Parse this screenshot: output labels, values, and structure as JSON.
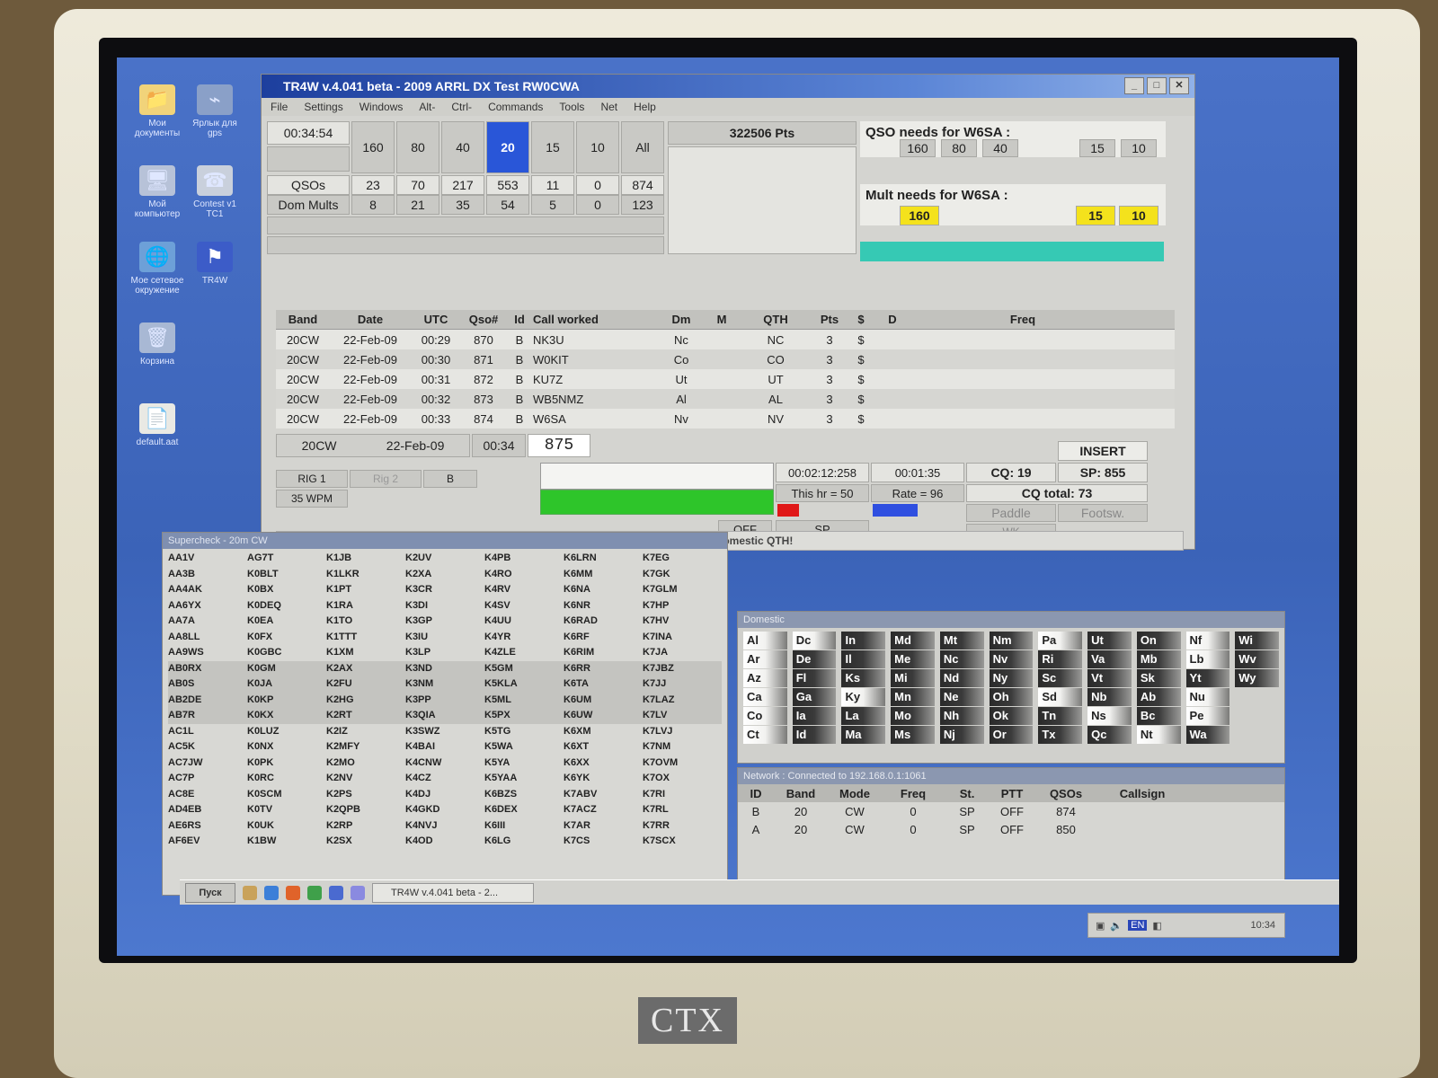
{
  "window": {
    "title": "TR4W v.4.041 beta - 2009 ARRL DX Test RW0CWA",
    "menu": [
      "File",
      "Settings",
      "Windows",
      "Alt-",
      "Ctrl-",
      "Commands",
      "Tools",
      "Net",
      "Help"
    ]
  },
  "summary": {
    "time": "00:34:54",
    "points": "322506 Pts",
    "bands": [
      "160",
      "80",
      "40",
      "20",
      "15",
      "10",
      "All"
    ],
    "active_band": "20",
    "qsos_label": "QSOs",
    "qsos": [
      "23",
      "70",
      "217",
      "553",
      "11",
      "0",
      "874"
    ],
    "mults_label": "Dom Mults",
    "mults": [
      "8",
      "21",
      "35",
      "54",
      "5",
      "0",
      "123"
    ]
  },
  "qso_needs": {
    "label": "QSO needs for W6SA :",
    "bands": [
      "160",
      "80",
      "40",
      "15",
      "10"
    ]
  },
  "mult_needs": {
    "label": "Mult needs for W6SA :",
    "bands": [
      "160",
      "15",
      "10"
    ],
    "highlight_color": "#f4e21c"
  },
  "log": {
    "columns": [
      "Band",
      "Date",
      "UTC",
      "Qso#",
      "Id",
      "Call worked",
      "Dm",
      "M",
      "QTH",
      "Pts",
      "$",
      "D",
      "Freq"
    ],
    "rows": [
      [
        "20CW",
        "22-Feb-09",
        "00:29",
        "870",
        "B",
        "NK3U",
        "Nc",
        "",
        "NC",
        "3",
        "$"
      ],
      [
        "20CW",
        "22-Feb-09",
        "00:30",
        "871",
        "B",
        "W0KIT",
        "Co",
        "",
        "CO",
        "3",
        "$"
      ],
      [
        "20CW",
        "22-Feb-09",
        "00:31",
        "872",
        "B",
        "KU7Z",
        "Ut",
        "",
        "UT",
        "3",
        "$"
      ],
      [
        "20CW",
        "22-Feb-09",
        "00:32",
        "873",
        "B",
        "WB5NMZ",
        "Al",
        "",
        "AL",
        "3",
        "$"
      ],
      [
        "20CW",
        "22-Feb-09",
        "00:33",
        "874",
        "B",
        "W6SA",
        "Nv",
        "",
        "NV",
        "3",
        "$"
      ]
    ]
  },
  "entry": {
    "band": "20CW",
    "date": "22-Feb-09",
    "utc": "00:34",
    "qso_number": "875",
    "rig1": "RIG 1",
    "rig2": "Rig 2",
    "rig_id": "B",
    "wpm": "35 WPM"
  },
  "stats": {
    "elapsed": "00:02:12:258",
    "timer": "00:01:35",
    "this_hr": "This hr = 50",
    "rate": "Rate = 96",
    "cq": "CQ: 19",
    "sp": "SP: 855",
    "cq_total": "CQ total: 73",
    "mode": "INSERT",
    "paddle": "Paddle",
    "footsw": "Footsw.",
    "wk": "WK",
    "off": "OFF",
    "sp_label": "SP"
  },
  "status_msg": "Improper domestic QTH!",
  "supercheck": {
    "title": "Supercheck - 20m CW",
    "calls": [
      "AA1V",
      "AG7T",
      "K1JB",
      "K2UV",
      "K4PB",
      "K6LRN",
      "K7EG",
      "AA3B",
      "K0BLT",
      "K1LKR",
      "K2XA",
      "K4RO",
      "K6MM",
      "K7GK",
      "AA4AK",
      "K0BX",
      "K1PT",
      "K3CR",
      "K4RV",
      "K6NA",
      "K7GLM",
      "AA6YX",
      "K0DEQ",
      "K1RA",
      "K3DI",
      "K4SV",
      "K6NR",
      "K7HP",
      "AA7A",
      "K0EA",
      "K1TO",
      "K3GP",
      "K4UU",
      "K6RAD",
      "K7HV",
      "AA8LL",
      "K0FX",
      "K1TTT",
      "K3IU",
      "K4YR",
      "K6RF",
      "K7INA",
      "AA9WS",
      "K0GBC",
      "K1XM",
      "K3LP",
      "K4ZLE",
      "K6RIM",
      "K7JA",
      "AB0RX",
      "K0GM",
      "K2AX",
      "K3ND",
      "K5GM",
      "K6RR",
      "K7JBZ",
      "AB0S",
      "K0JA",
      "K2FU",
      "K3NM",
      "K5KLA",
      "K6TA",
      "K7JJ",
      "AB2DE",
      "K0KP",
      "K2HG",
      "K3PP",
      "K5ML",
      "K6UM",
      "K7LAZ",
      "AB7R",
      "K0KX",
      "K2RT",
      "K3QIA",
      "K5PX",
      "K6UW",
      "K7LV",
      "AC1L",
      "K0LUZ",
      "K2IZ",
      "K3SWZ",
      "K5TG",
      "K6XM",
      "K7LVJ",
      "AC5K",
      "K0NX",
      "K2MFY",
      "K4BAI",
      "K5WA",
      "K6XT",
      "K7NM",
      "AC7JW",
      "K0PK",
      "K2MO",
      "K4CNW",
      "K5YA",
      "K6XX",
      "K7OVM",
      "AC7P",
      "K0RC",
      "K2NV",
      "K4CZ",
      "K5YAA",
      "K6YK",
      "K7OX",
      "AC8E",
      "K0SCM",
      "K2PS",
      "K4DJ",
      "K6BZS",
      "K7ABV",
      "K7RI",
      "AD4EB",
      "K0TV",
      "K2QPB",
      "K4GKD",
      "K6DEX",
      "K7ACZ",
      "K7RL",
      "AE6RS",
      "K0UK",
      "K2RP",
      "K4NVJ",
      "K6III",
      "K7AR",
      "K7RR",
      "AF6EV",
      "K1BW",
      "K2SX",
      "K4OD",
      "K6LG",
      "K7CS",
      "K7SCX"
    ]
  },
  "domestic": {
    "title": "Domestic",
    "items": [
      {
        "t": "Al",
        "s": "w"
      },
      {
        "t": "Ar",
        "s": "w"
      },
      {
        "t": "Az",
        "s": "w"
      },
      {
        "t": "Ca",
        "s": "w"
      },
      {
        "t": "Co",
        "s": "w"
      },
      {
        "t": "Ct",
        "s": "w"
      },
      {
        "t": "Dc",
        "s": "w"
      },
      {
        "t": "De",
        "s": "d"
      },
      {
        "t": "Fl",
        "s": "d"
      },
      {
        "t": "Ga",
        "s": "d"
      },
      {
        "t": "Ia",
        "s": "d"
      },
      {
        "t": "Id",
        "s": "d"
      },
      {
        "t": "In",
        "s": "d"
      },
      {
        "t": "Il",
        "s": "d"
      },
      {
        "t": "Ks",
        "s": "d"
      },
      {
        "t": "Ky",
        "s": "w"
      },
      {
        "t": "La",
        "s": "d"
      },
      {
        "t": "Ma",
        "s": "d"
      },
      {
        "t": "Md",
        "s": "d"
      },
      {
        "t": "Me",
        "s": "d"
      },
      {
        "t": "Mi",
        "s": "d"
      },
      {
        "t": "Mn",
        "s": "d"
      },
      {
        "t": "Mo",
        "s": "d"
      },
      {
        "t": "Ms",
        "s": "d"
      },
      {
        "t": "Mt",
        "s": "d"
      },
      {
        "t": "Nc",
        "s": "d"
      },
      {
        "t": "Nd",
        "s": "d"
      },
      {
        "t": "Ne",
        "s": "d"
      },
      {
        "t": "Nh",
        "s": "d"
      },
      {
        "t": "Nj",
        "s": "d"
      },
      {
        "t": "Nm",
        "s": "d"
      },
      {
        "t": "Nv",
        "s": "d"
      },
      {
        "t": "Ny",
        "s": "d"
      },
      {
        "t": "Oh",
        "s": "d"
      },
      {
        "t": "Ok",
        "s": "d"
      },
      {
        "t": "Or",
        "s": "d"
      },
      {
        "t": "Pa",
        "s": "w"
      },
      {
        "t": "Ri",
        "s": "d"
      },
      {
        "t": "Sc",
        "s": "d"
      },
      {
        "t": "Sd",
        "s": "w"
      },
      {
        "t": "Tn",
        "s": "d"
      },
      {
        "t": "Tx",
        "s": "d"
      },
      {
        "t": "Ut",
        "s": "d"
      },
      {
        "t": "Va",
        "s": "d"
      },
      {
        "t": "Vt",
        "s": "d"
      },
      {
        "t": "Nb",
        "s": "d"
      },
      {
        "t": "Ns",
        "s": "w"
      },
      {
        "t": "Qc",
        "s": "d"
      },
      {
        "t": "On",
        "s": "d"
      },
      {
        "t": "Mb",
        "s": "d"
      },
      {
        "t": "Sk",
        "s": "d"
      },
      {
        "t": "Ab",
        "s": "d"
      },
      {
        "t": "Bc",
        "s": "d"
      },
      {
        "t": "Nt",
        "s": "w"
      },
      {
        "t": "Nf",
        "s": "w"
      },
      {
        "t": "Lb",
        "s": "w"
      },
      {
        "t": "Yt",
        "s": "d"
      },
      {
        "t": "Nu",
        "s": "w"
      },
      {
        "t": "Pe",
        "s": "w"
      },
      {
        "t": "Wa",
        "s": "d"
      },
      {
        "t": "Wi",
        "s": "d"
      },
      {
        "t": "Wv",
        "s": "d"
      },
      {
        "t": "Wy",
        "s": "d"
      },
      {
        "t": "",
        "s": ""
      },
      {
        "t": "",
        "s": ""
      },
      {
        "t": "",
        "s": ""
      }
    ]
  },
  "network": {
    "title": "Network : Connected to 192.168.0.1:1061",
    "columns": [
      "ID",
      "Band",
      "Mode",
      "Freq",
      "St.",
      "PTT",
      "QSOs",
      "Callsign"
    ],
    "rows": [
      [
        "B",
        "20",
        "CW",
        "0",
        "SP",
        "OFF",
        "874",
        ""
      ],
      [
        "A",
        "20",
        "CW",
        "0",
        "SP",
        "OFF",
        "850",
        ""
      ]
    ]
  },
  "desktop_icons": [
    "Мои документы",
    "Ярлык для gps",
    "Мой компьютер",
    "Contest v1 TC1",
    "Мое сетевое окружение",
    "TR4W",
    "Корзина",
    "default.aat"
  ],
  "taskbar": {
    "start": "Пуск",
    "task": "TR4W v.4.041 beta - 2...",
    "lang": "EN",
    "clock": "10:34"
  },
  "brand": "CTX",
  "colors": {
    "active_band": "#2956d8",
    "green_bar": "#2ec52a",
    "red_chip": "#e01818",
    "blue_chip": "#2f4fe0",
    "cyan_bar": "#36c9b4"
  }
}
